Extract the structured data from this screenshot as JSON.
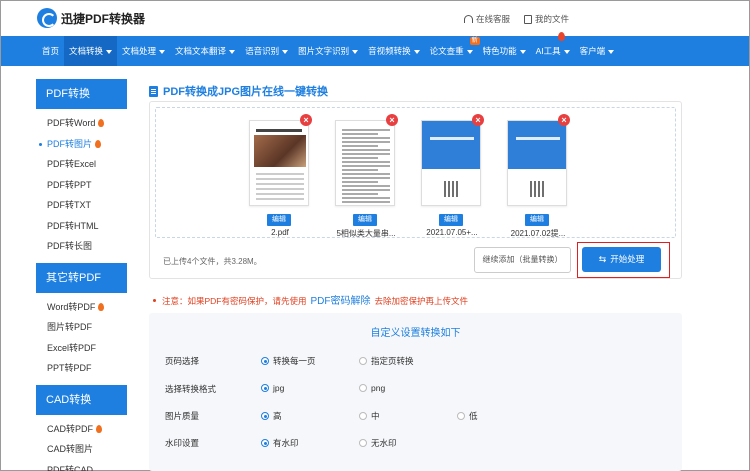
{
  "header": {
    "brand": "迅捷PDF转换器",
    "links": [
      {
        "label": "在线客服",
        "icon": "headset-icon"
      },
      {
        "label": "我的文件",
        "icon": "file-icon"
      }
    ]
  },
  "nav": {
    "items": [
      {
        "label": "首页",
        "dropdown": false
      },
      {
        "label": "文档转换",
        "dropdown": true,
        "active": true
      },
      {
        "label": "文档处理",
        "dropdown": true
      },
      {
        "label": "文档文本翻译",
        "dropdown": true
      },
      {
        "label": "语音识别",
        "dropdown": true
      },
      {
        "label": "图片文字识别",
        "dropdown": true
      },
      {
        "label": "音视频转换",
        "dropdown": true
      },
      {
        "label": "论文查重",
        "dropdown": true,
        "badge": "新"
      },
      {
        "label": "特色功能",
        "dropdown": true
      },
      {
        "label": "AI工具",
        "dropdown": true,
        "hot": true
      },
      {
        "label": "客户端",
        "dropdown": true
      }
    ]
  },
  "sidebar": {
    "sections": [
      {
        "title": "PDF转换",
        "items": [
          {
            "label": "PDF转Word",
            "hot": true
          },
          {
            "label": "PDF转图片",
            "hot": true,
            "active": true
          },
          {
            "label": "PDF转Excel"
          },
          {
            "label": "PDF转PPT"
          },
          {
            "label": "PDF转TXT"
          },
          {
            "label": "PDF转HTML"
          },
          {
            "label": "PDF转长图"
          }
        ]
      },
      {
        "title": "其它转PDF",
        "items": [
          {
            "label": "Word转PDF",
            "hot": true
          },
          {
            "label": "图片转PDF"
          },
          {
            "label": "Excel转PDF"
          },
          {
            "label": "PPT转PDF"
          }
        ]
      },
      {
        "title": "CAD转换",
        "items": [
          {
            "label": "CAD转PDF",
            "hot": true
          },
          {
            "label": "CAD转图片"
          },
          {
            "label": "PDF转CAD"
          }
        ]
      }
    ]
  },
  "main": {
    "title": "PDF转换成JPG图片在线一键转换",
    "files": [
      {
        "name": "2.pdf",
        "edit_label": "编辑",
        "thumb": "photo"
      },
      {
        "name": "5相似类大量串...",
        "edit_label": "编辑",
        "thumb": "text"
      },
      {
        "name": "2021.07.05+...",
        "edit_label": "编辑",
        "thumb": "blue"
      },
      {
        "name": "2021.07.02提...",
        "edit_label": "编辑",
        "thumb": "blue"
      }
    ],
    "status": "已上传4个文件，共3.28M。",
    "continue_label": "继续添加（批量转换）",
    "start_label": "开始处理"
  },
  "note": {
    "prefix": "注意：如果PDF有密码保护，请先使用",
    "link": "PDF密码解除",
    "suffix": "去除加密保护再上传文件"
  },
  "settings": {
    "title": "自定义设置转换如下",
    "rows": [
      {
        "label": "页码选择",
        "options": [
          {
            "label": "转换每一页",
            "checked": true
          },
          {
            "label": "指定页转换",
            "checked": false
          }
        ]
      },
      {
        "label": "选择转换格式",
        "options": [
          {
            "label": "jpg",
            "checked": true
          },
          {
            "label": "png",
            "checked": false
          }
        ]
      },
      {
        "label": "图片质量",
        "options": [
          {
            "label": "高",
            "checked": true
          },
          {
            "label": "中",
            "checked": false
          },
          {
            "label": "低",
            "checked": false
          }
        ]
      },
      {
        "label": "水印设置",
        "options": [
          {
            "label": "有水印",
            "checked": true
          },
          {
            "label": "无水印",
            "checked": false
          }
        ]
      }
    ]
  },
  "colors": {
    "accent": "#1e7fe0",
    "nav_active": "#1569c4",
    "delete": "#e84040",
    "highlight_border": "#e02020",
    "warning_text": "#e04020"
  }
}
